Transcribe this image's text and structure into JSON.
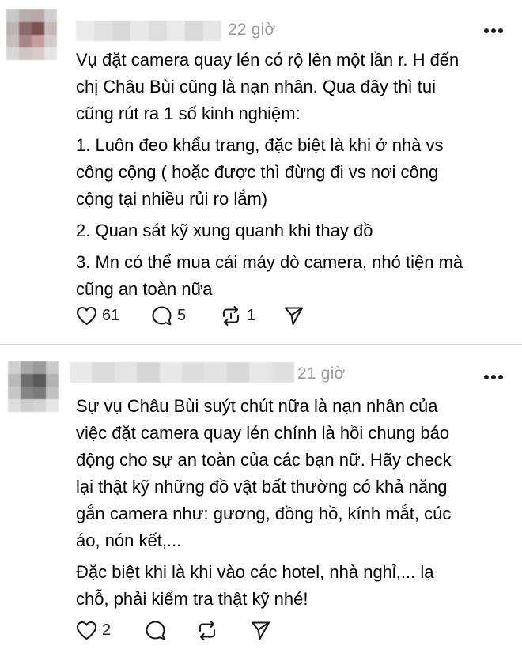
{
  "posts": [
    {
      "time": "22 giờ",
      "lines": [
        [
          "Vụ đặt camera quay lén có rộ lên một lần r. H đến",
          "chị Châu Bùi cũng là nạn nhân. Qua đây thì tui",
          "cũng rút ra 1 số kinh nghiệm:"
        ],
        [
          "1. Luôn đeo khẩu trang, đặc biệt là khi ở nhà vs",
          "công cộng ( hoặc được thì đừng đi vs nơi công",
          "cộng tại nhiều rủi ro lắm)"
        ],
        [
          "2. Quan sát kỹ xung quanh khi thay đồ"
        ],
        [
          "3. Mn có thể mua cái máy dò camera, nhỏ tiện mà",
          "cũng an toàn nữa"
        ]
      ],
      "likes": "61",
      "comments": "5",
      "reposts": "1"
    },
    {
      "time": "21 giờ",
      "lines": [
        [
          "Sự vụ Châu Bùi suýt chút nữa là nạn nhân của",
          "việc đặt camera quay lén chính là hồi chung báo",
          "động cho sự an toàn của các bạn nữ. Hãy check",
          "lại thật kỹ những đồ vật bất thường có khả năng",
          "gắn camera như: gương, đồng hồ, kính mắt, cúc",
          "áo, nón kết,..."
        ],
        [
          "Đặc biệt khi là khi vào các hotel, nhà nghỉ,... lạ",
          "chỗ, phải kiểm tra thật kỹ nhé!"
        ]
      ],
      "likes": "2"
    }
  ],
  "icons": {
    "like": "heart-icon",
    "comment": "comment-bubble-icon",
    "repost": "repost-icon",
    "share": "send-icon",
    "more": "more-horizontal-icon"
  },
  "colors": {
    "time": "#9a9a9a",
    "icon": "#1a1a1a",
    "divider": "#dcdcdc"
  }
}
